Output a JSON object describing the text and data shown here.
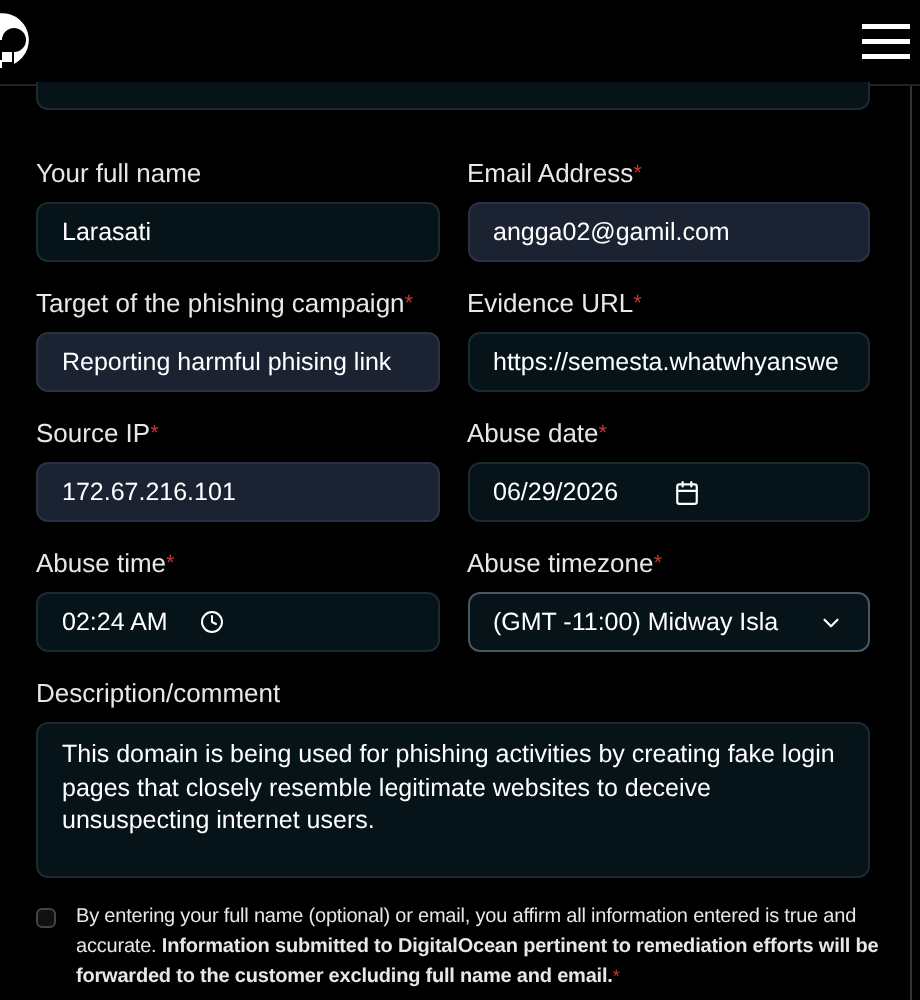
{
  "form": {
    "fields": [
      {
        "label": "Your full name",
        "kind": "text",
        "value": "Larasati",
        "autofilled": false
      },
      {
        "label": "Email Address",
        "required_mark": "*",
        "kind": "text",
        "value": "angga02@gamil.com",
        "autofilled": true
      },
      {
        "label": "Target of the phishing campaign",
        "required_mark": "*",
        "kind": "text",
        "value": "Reporting harmful phising link",
        "autofilled": true
      },
      {
        "label": "Evidence URL",
        "required_mark": "*",
        "kind": "text",
        "value": "https://semesta.whatwhyanswe",
        "autofilled": false
      },
      {
        "label": "Source IP",
        "required_mark": "*",
        "kind": "text",
        "value": "172.67.216.101",
        "autofilled": true
      },
      {
        "label": "Abuse date",
        "required_mark": "*",
        "kind": "date",
        "value": "06/29/2026",
        "autofilled": false
      },
      {
        "label": "Abuse time",
        "required_mark": "*",
        "kind": "time",
        "value": "02:24 AM",
        "autofilled": false
      },
      {
        "label": "Abuse timezone",
        "required_mark": "*",
        "kind": "select",
        "value": "(GMT -11:00) Midway Isla",
        "autofilled": false
      }
    ],
    "description": {
      "label": "Description/comment",
      "value": "This domain is being used for phishing activities by creating fake login pages that closely resemble legitimate websites to deceive unsuspecting internet users."
    },
    "consent": {
      "checked": false,
      "text": "By entering your full name (optional) or email, you affirm all information entered is true and accurate. **Information submitted to DigitalOcean pertinent to remediation efforts will be forwarded to the customer excluding full name and email.**",
      "required_mark": "*"
    }
  }
}
